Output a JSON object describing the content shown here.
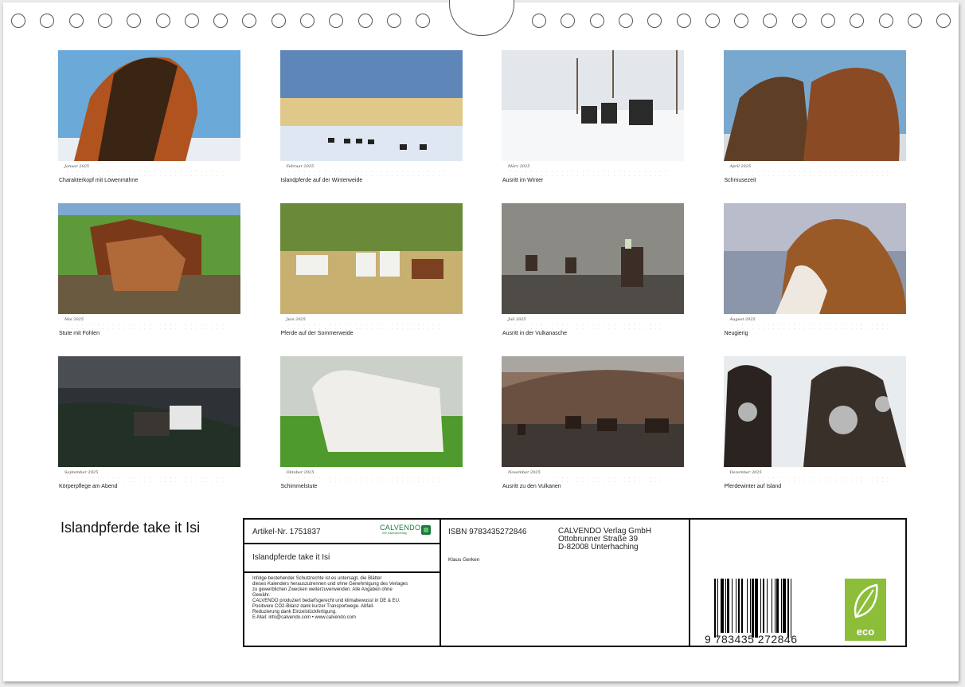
{
  "calendar": {
    "title": "Islandpferde take it Isi",
    "months": [
      {
        "name": "Januar 2025",
        "caption": "Charakterkopf mit Löwenmähne",
        "scene": "portrait-blue"
      },
      {
        "name": "Februar 2025",
        "caption": "Islandpferde auf der Winterweide",
        "scene": "winter-herd"
      },
      {
        "name": "März 2025",
        "caption": "Ausritt im Winter",
        "scene": "winter-riders"
      },
      {
        "name": "April 2025",
        "caption": "Schmusezeit",
        "scene": "two-heads"
      },
      {
        "name": "Mai 2025",
        "caption": "Stute mit Fohlen",
        "scene": "mare-foal"
      },
      {
        "name": "Juni 2025",
        "caption": "Pferde auf der Sommerweide",
        "scene": "summer-pasture"
      },
      {
        "name": "Juli 2025",
        "caption": "Ausritt in der Vulkanasche",
        "scene": "volcanic-dust"
      },
      {
        "name": "August 2025",
        "caption": "Neugierig",
        "scene": "windy-portrait"
      },
      {
        "name": "September 2025",
        "caption": "Körperpflege am Abend",
        "scene": "dark-evening"
      },
      {
        "name": "Oktober 2025",
        "caption": "Schimmelstute",
        "scene": "white-mare"
      },
      {
        "name": "November 2025",
        "caption": "Ausritt zu den Vulkanen",
        "scene": "volcano-ride"
      },
      {
        "name": "Dezember 2025",
        "caption": "Pferdewinter auf Island",
        "scene": "snow-heads"
      }
    ]
  },
  "info": {
    "article": "Artikel-Nr. 1751837",
    "logo_text": "CALVENDO",
    "logo_sub": "Ihre Kalenderverlag",
    "title": "Islandpferde take it Isi",
    "legal": [
      "Infolge bestehender Schutzrechte ist es untersagt, die Blätter",
      "dieses Kalenders herauszutrennen und ohne Genehmigung des Verlages",
      "zu gewerblichen Zwecken weiterzuverwenden. Alle Angaben ohne",
      "Gewähr.",
      "CALVENDO produziert bedarfsgerecht und klimabewusst in DE & EU.",
      "Positivere CO2-Bilanz dank kurzer Transportwege. Abfall-",
      "Reduzierung dank Einzelstückfertigung.",
      "E-Mail: info@calvendo.com • www.calvendo.com"
    ],
    "isbn": "ISBN 9783435272846",
    "publisher": [
      "CALVENDO Verlag GmbH",
      "Ottobrunner Straße 39",
      "D-82008 Unterhaching"
    ],
    "author": "Klaus Gerken",
    "barcode_number": "9   783435   272846",
    "eco_label": "eco"
  },
  "colors": {
    "border": "#111111",
    "brand_green": "#1a7a3c",
    "eco_green": "#8dbe3a"
  }
}
